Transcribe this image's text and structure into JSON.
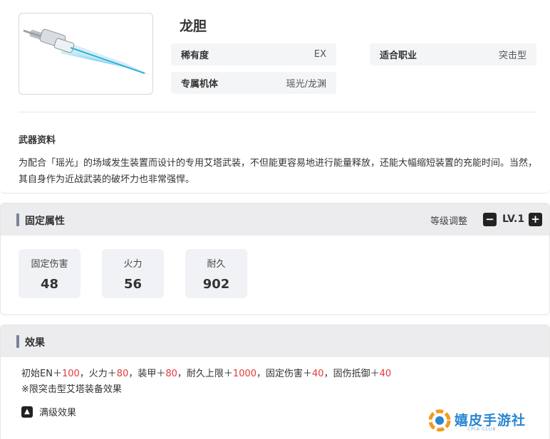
{
  "weapon": {
    "name": "龙胆",
    "image_icon": "lance-weapon-icon",
    "rarity_label": "稀有度",
    "rarity_value": "EX",
    "job_label": "适合职业",
    "job_value": "突击型",
    "exclusive_label": "专属机体",
    "exclusive_value": "瑶光/龙渊",
    "info_title": "武器资料",
    "description": "为配合「瑶光」的场域发生装置而设计的专用艾塔武装，不但能更容易地进行能量释放，还能大幅缩短装置的充能时间。当然，其自身作为近战武装的破坏力也非常强悍。"
  },
  "fixed_attrs": {
    "title": "固定属性",
    "level_adjust_label": "等级调整",
    "level_value": "LV.1",
    "minus_icon": "minus",
    "plus_icon": "plus",
    "stats": [
      {
        "label": "固定伤害",
        "value": "48"
      },
      {
        "label": "火力",
        "value": "56"
      },
      {
        "label": "耐久",
        "value": "902"
      }
    ]
  },
  "effects": {
    "title": "效果",
    "line1": [
      {
        "text": "初始EN＋",
        "hl": false
      },
      {
        "text": "100",
        "hl": true
      },
      {
        "text": "，火力＋",
        "hl": false
      },
      {
        "text": "80",
        "hl": true
      },
      {
        "text": "，装甲＋",
        "hl": false
      },
      {
        "text": "80",
        "hl": true
      },
      {
        "text": "，耐久上限＋",
        "hl": false
      },
      {
        "text": "1000",
        "hl": true
      },
      {
        "text": "，固定伤害＋",
        "hl": false
      },
      {
        "text": "40",
        "hl": true
      },
      {
        "text": "，固伤抵御＋",
        "hl": false
      },
      {
        "text": "40",
        "hl": true
      }
    ],
    "note": "※限突击型艾塔装备效果",
    "max_label": "满级效果",
    "max_icon": "arrow-up-icon"
  },
  "watermark": {
    "name": "嬉皮手游社",
    "sub": "CPIA CLUB"
  },
  "colors": {
    "highlight": "#e4393c",
    "accent_bar": "#7a8294",
    "watermark_blue": "#2a86d2",
    "watermark_orange": "#f39a1e"
  }
}
